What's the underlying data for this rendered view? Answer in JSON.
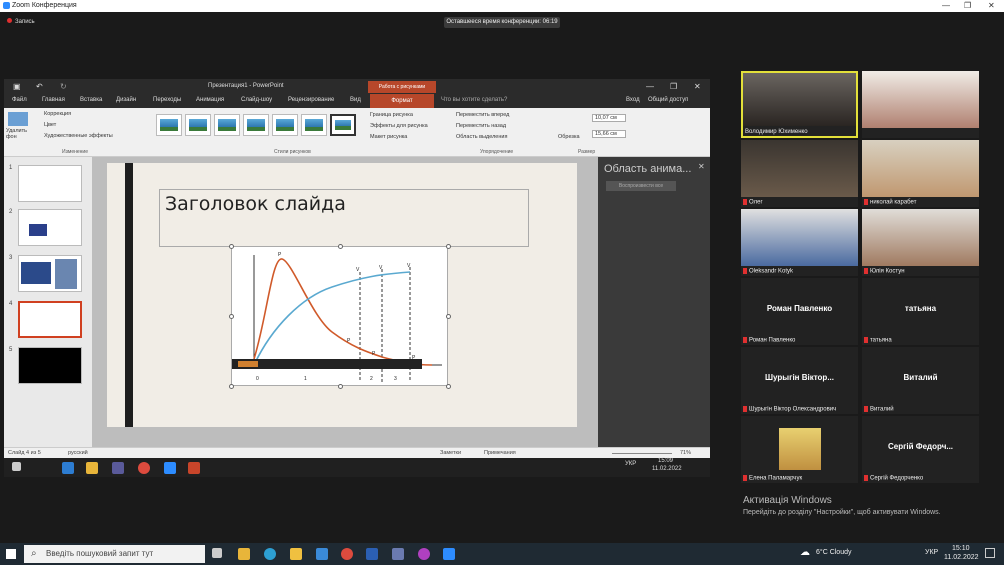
{
  "zoom": {
    "title": "Zoom Конференция",
    "record": "Запись",
    "timer": "Оставшееся время конференции: 06:19"
  },
  "ppt": {
    "window_title": "Презентация1 - PowerPoint",
    "context_label": "Работа с рисунками",
    "tabs": [
      "Файл",
      "Главная",
      "Вставка",
      "Дизайн",
      "Переходы",
      "Анимация",
      "Слайд-шоу",
      "Рецензирование",
      "Вид"
    ],
    "active_tab": "Формат",
    "tell_me": "Что вы хотите сделать?",
    "signin": "Вход",
    "share": "Общий доступ",
    "ribbon": {
      "remove_bg": "Удалить фон",
      "correction": "Коррекция",
      "color": "Цвет",
      "art_effects": "Художественные эффекты",
      "group_change": "Изменение",
      "group_styles": "Стили рисунков",
      "border": "Граница рисунка",
      "effects": "Эффекты для рисунка",
      "layout": "Макет рисунка",
      "forward": "Переместить вперед",
      "backward": "Переместить назад",
      "selection": "Область выделения",
      "group_arrange": "Упорядочение",
      "crop": "Обрезка",
      "height": "10,07 см",
      "width": "15,66 см",
      "group_size": "Размер"
    },
    "slides": [
      "1",
      "2",
      "3",
      "4",
      "5"
    ],
    "slide_title": "Заголовок слайда",
    "anim_pane": {
      "title": "Область анима...",
      "play_all": "Воспроизвести все"
    },
    "status": {
      "slide": "Слайд 4 из 5",
      "lang": "русский",
      "notes": "Заметки",
      "comments": "Примечания",
      "zoom": "71%"
    },
    "inner_taskbar": {
      "time": "15:09",
      "date": "11.02.2022",
      "lang": "УКР"
    }
  },
  "chart_labels": {
    "p_max": "P",
    "v1": "V",
    "v2": "V",
    "v3": "V",
    "seg1": "1",
    "seg2": "2",
    "seg3": "3",
    "seg0": "0",
    "pkm": "P",
    "pa": "P",
    "pb": "P"
  },
  "participants": [
    {
      "name": "Володимир Юхименко",
      "big": "",
      "active": true,
      "video": true
    },
    {
      "name": "",
      "big": "",
      "active": false,
      "video": true
    },
    {
      "name": "Олег",
      "big": "",
      "active": false,
      "video": true
    },
    {
      "name": "николай карабет",
      "big": "",
      "active": false,
      "video": true
    },
    {
      "name": "Oleksandr Kotyk",
      "big": "",
      "active": false,
      "video": true
    },
    {
      "name": "Юлія Костун",
      "big": "",
      "active": false,
      "video": true
    },
    {
      "name": "Роман Павленко",
      "big": "Роман Павленко",
      "active": false,
      "video": false
    },
    {
      "name": "татьяна",
      "big": "татьяна",
      "active": false,
      "video": false
    },
    {
      "name": "Шурыгін Віктор Олександрович",
      "big": "Шурыгін Віктор...",
      "active": false,
      "video": false
    },
    {
      "name": "Виталий",
      "big": "Виталий",
      "active": false,
      "video": false
    },
    {
      "name": "Елена Паламарчук",
      "big": "",
      "active": false,
      "video": true
    },
    {
      "name": "Сергій Федорченко",
      "big": "Сергій Федорч...",
      "active": false,
      "video": false
    }
  ],
  "activation": {
    "title": "Активація Windows",
    "sub": "Перейдіть до розділу \"Настройки\", щоб активувати Windows."
  },
  "taskbar": {
    "search": "Введіть пошуковий запит тут",
    "weather": "6°C  Cloudy",
    "lang": "УКР",
    "time": "15:10",
    "date": "11.02.2022"
  }
}
